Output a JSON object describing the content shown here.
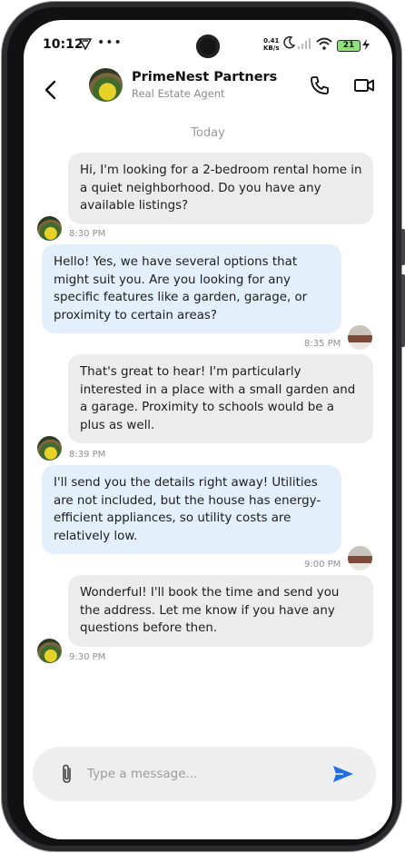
{
  "status_bar": {
    "time": "10:12",
    "left_icons": [
      "vpn-icon",
      "more-icon"
    ],
    "speed_value": "0.41",
    "speed_unit": "KB/s",
    "battery": "21"
  },
  "header": {
    "contact_name": "PrimeNest Partners",
    "contact_role": "Real Estate Agent",
    "actions": [
      "phone-icon",
      "video-icon"
    ]
  },
  "chat": {
    "day_label": "Today",
    "messages": [
      {
        "side": "sent",
        "text": "Hi, I'm looking for a 2-bedroom rental home in a quiet neighborhood. Do you have any available listings?",
        "time": "8:30 PM"
      },
      {
        "side": "received",
        "text": "Hello! Yes, we have several options that might suit you. Are you looking for any specific features like a garden, garage, or proximity to certain areas?",
        "time": "8:35 PM"
      },
      {
        "side": "sent",
        "text": "That's great to hear! I'm particularly interested in a place with a small garden and a garage. Proximity to schools would be a plus as well.",
        "time": "8:39 PM"
      },
      {
        "side": "received",
        "text": "I'll send you the details right away! Utilities are not included, but the house has energy-efficient appliances, so utility costs are relatively low.",
        "time": "9:00 PM"
      },
      {
        "side": "sent",
        "text": "Wonderful! I'll book the time and send you the address. Let me know if you have any questions before then.",
        "time": "9:30 PM"
      }
    ]
  },
  "composer": {
    "placeholder": "Type a message...",
    "value": "",
    "accent": "#1e6fe0"
  }
}
